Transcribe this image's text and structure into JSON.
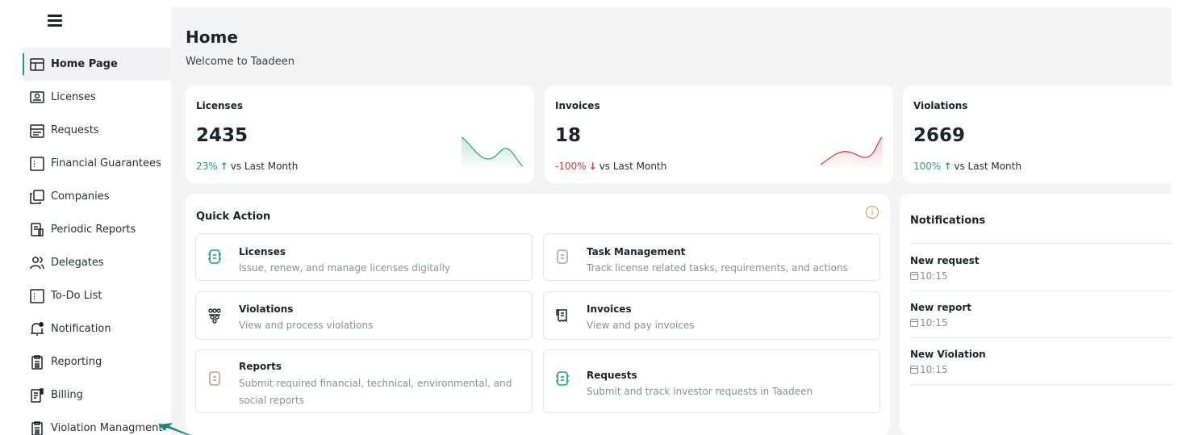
{
  "sidebar": {
    "menu_icon": "hamburger-menu-icon",
    "items": [
      {
        "label": "Home Page",
        "icon": "layout-icon",
        "active": true
      },
      {
        "label": "Licenses",
        "icon": "id-card-icon"
      },
      {
        "label": "Requests",
        "icon": "list-box-icon"
      },
      {
        "label": "Financial Guarantees",
        "icon": "document-box-icon"
      },
      {
        "label": "Companies",
        "icon": "copy-icon"
      },
      {
        "label": "Periodic Reports",
        "icon": "report-icon"
      },
      {
        "label": "Delegates",
        "icon": "users-icon"
      },
      {
        "label": "To-Do List",
        "icon": "document-box-icon"
      },
      {
        "label": "Notification",
        "icon": "bell-icon"
      },
      {
        "label": "Reporting",
        "icon": "clipboard-icon"
      },
      {
        "label": "Billing",
        "icon": "bill-icon"
      },
      {
        "label": "Violation Managment",
        "icon": "clipboard-icon"
      }
    ]
  },
  "header": {
    "title": "Home",
    "subtitle": "Welcome to Taadeen"
  },
  "stats": [
    {
      "title": "Licenses",
      "value": "2435",
      "pct": "23%",
      "direction": "up",
      "compare": "vs Last Month",
      "spark_color": "#1aa37a"
    },
    {
      "title": "Invoices",
      "value": "18",
      "pct": "-100%",
      "direction": "down",
      "compare": "vs Last Month",
      "spark_color": "#e0323a"
    },
    {
      "title": "Violations",
      "value": "2669",
      "pct": "100%",
      "direction": "up",
      "compare": "vs Last Month"
    }
  ],
  "quick_action": {
    "title": "Quick Action",
    "info_icon": "info-icon",
    "items": [
      {
        "name": "Licenses",
        "desc": "Issue, renew, and manage licenses digitally",
        "icon": "license-icon"
      },
      {
        "name": "Task Management",
        "desc": "Track license related tasks, requirements, and actions",
        "icon": "task-icon"
      },
      {
        "name": "Violations",
        "desc": "View and process violations",
        "icon": "violations-icon"
      },
      {
        "name": "Invoices",
        "desc": "View and pay invoices",
        "icon": "invoice-icon"
      },
      {
        "name": "Reports",
        "desc": "Submit required financial, technical, environmental, and social reports",
        "icon": "report-icon"
      },
      {
        "name": "Requests",
        "desc": "Submit and track investor requests in Taadeen",
        "icon": "request-icon"
      }
    ]
  },
  "notifications": {
    "title": "Notifications",
    "items": [
      {
        "name": "New request",
        "time": "10:15"
      },
      {
        "name": "New report",
        "time": "10:15"
      },
      {
        "name": "New Violation",
        "time": "10:15"
      }
    ]
  },
  "colors": {
    "accent": "#1aa37a",
    "negative": "#e0323a",
    "panel_bg": "#f4f4f4"
  }
}
